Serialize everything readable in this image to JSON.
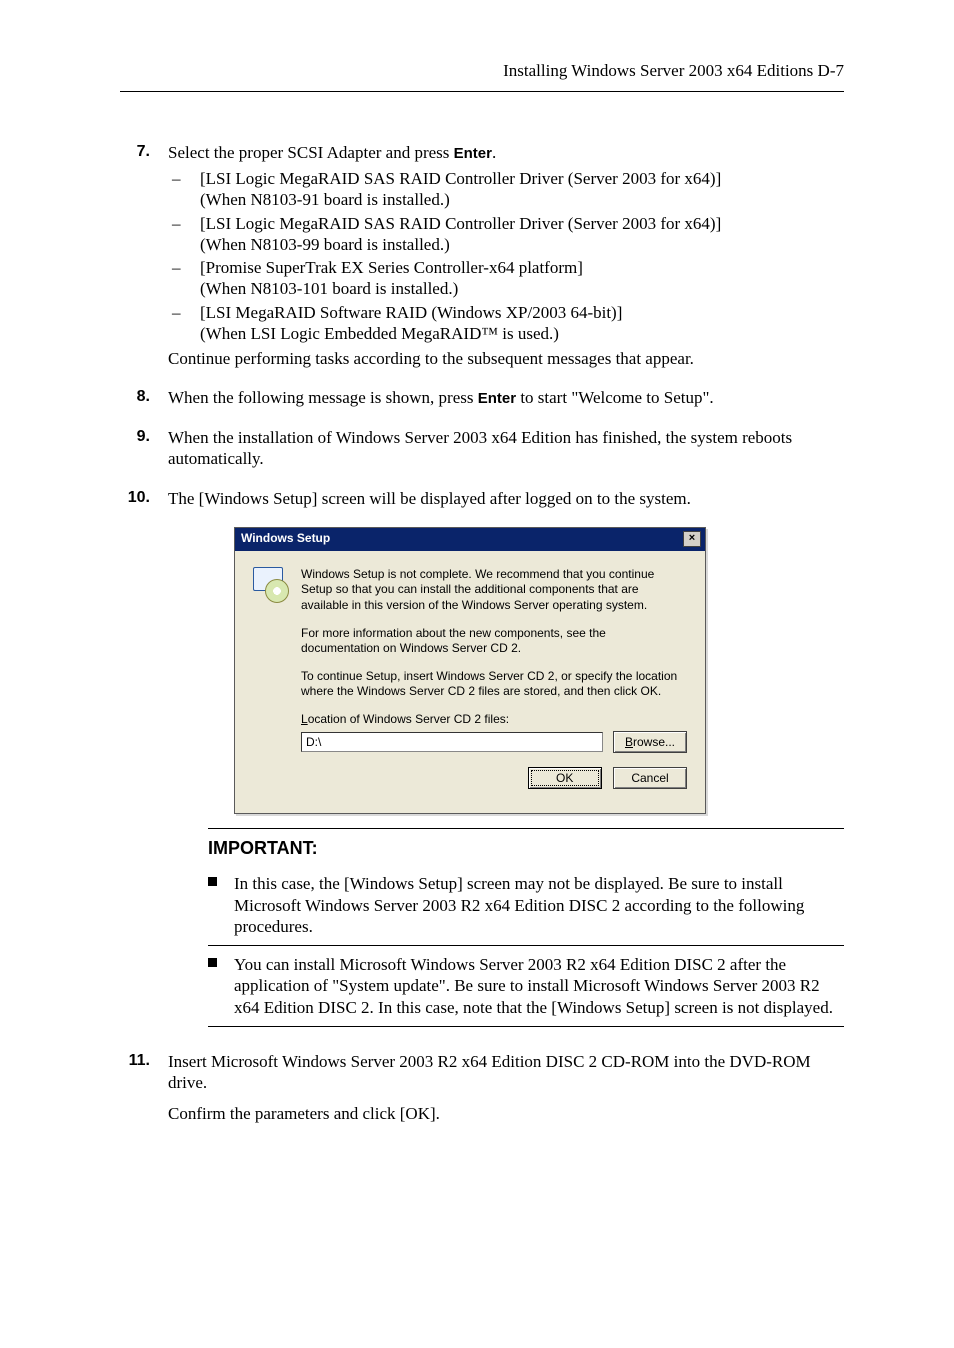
{
  "header": {
    "running_head": "Installing Windows Server 2003 x64 Editions   D-7"
  },
  "steps": {
    "s7": {
      "num": "7.",
      "lead_a": "Select the proper SCSI Adapter and press ",
      "lead_key": "Enter",
      "lead_b": ".",
      "items": [
        {
          "l1": "[LSI Logic MegaRAID SAS RAID Controller Driver (Server 2003 for x64)]",
          "l2": "(When N8103-91 board is installed.)"
        },
        {
          "l1": "[LSI Logic MegaRAID SAS RAID Controller Driver (Server 2003 for x64)]",
          "l2": "(When N8103-99 board is installed.)"
        },
        {
          "l1": "[Promise SuperTrak EX Series Controller-x64 platform]",
          "l2": "(When N8103-101 board is installed.)"
        },
        {
          "l1": "[LSI MegaRAID Software RAID (Windows XP/2003 64-bit)]",
          "l2": "(When LSI Logic Embedded MegaRAID™ is used.)"
        }
      ],
      "trail": "Continue performing tasks according to the subsequent messages that appear."
    },
    "s8": {
      "num": "8.",
      "a": "When the following message is shown, press ",
      "key": "Enter",
      "b": " to start \"Welcome to Setup\"."
    },
    "s9": {
      "num": "9.",
      "text": "When the installation of Windows Server 2003 x64 Edition has finished, the system reboots automatically."
    },
    "s10": {
      "num": "10.",
      "text": "The [Windows Setup] screen will be displayed after logged on to the system."
    },
    "s11": {
      "num": "11.",
      "p1": "Insert Microsoft Windows Server 2003 R2 x64 Edition DISC 2 CD-ROM into the DVD-ROM drive.",
      "p2": "Confirm the parameters and click [OK]."
    }
  },
  "dialog": {
    "title": "Windows Setup",
    "close": "×",
    "p1": "Windows Setup is not complete. We recommend that you continue Setup so that you can install the additional components that are available in this version of the Windows Server operating system.",
    "p2": "For more information about the new components, see the documentation on Windows Server CD 2.",
    "p3": "To continue Setup, insert Windows Server CD 2, or specify the location where the Windows Server CD 2 files are stored, and then click OK.",
    "label_pre": "L",
    "label_rest": "ocation of Windows Server CD 2 files:",
    "input_value": "D:\\",
    "browse_pre": "B",
    "browse_rest": "rowse...",
    "ok": "OK",
    "cancel": "Cancel"
  },
  "important": {
    "title": "IMPORTANT:",
    "items": [
      "In this case, the [Windows Setup] screen may not be displayed. Be sure to install Microsoft Windows Server 2003 R2 x64 Edition DISC 2 according to the following procedures.",
      "You can install Microsoft Windows Server 2003 R2 x64 Edition DISC 2 after the application of \"System update\". Be sure to install Microsoft Windows Server 2003 R2 x64 Edition DISC 2. In this case, note that the [Windows Setup] screen is not displayed."
    ]
  }
}
